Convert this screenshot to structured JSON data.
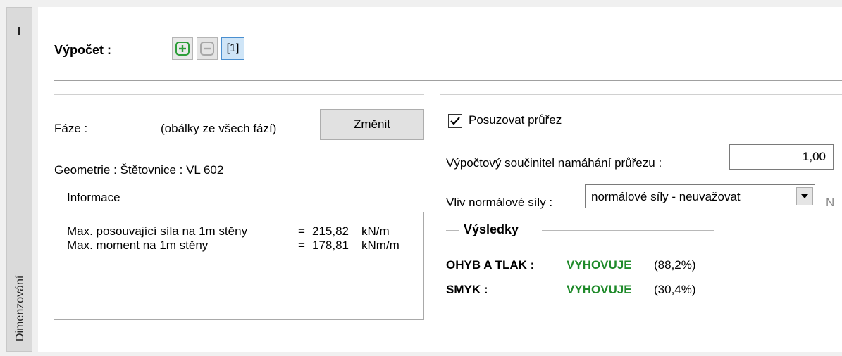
{
  "side_tab": {
    "label": "Dimenzování"
  },
  "toolbar": {
    "title": "Výpočet :",
    "add_label": "+",
    "remove_label": "−",
    "stage_label": "[1]"
  },
  "left": {
    "phase_label": "Fáze :",
    "phase_value": "(obálky ze všech fází)",
    "change_button": "Změnit",
    "geometry": "Geometrie : Štětovnice : VL 602",
    "info_group": "Informace",
    "info_rows": [
      {
        "name": "Max. posouvající síla na 1m stěny",
        "eq": "=",
        "value": "215,82",
        "unit": "kN/m"
      },
      {
        "name": "Max. moment na 1m stěny",
        "eq": "=",
        "value": "178,81",
        "unit": "kNm/m"
      }
    ]
  },
  "right": {
    "check_label": "Posuzovat průřez",
    "check_checked": true,
    "coef_label": "Výpočtový součinitel namáhání průřezu :",
    "coef_value": "1,00",
    "normal_label": "Vliv normálové síly :",
    "normal_value": "normálové síly - neuvažovat",
    "normal_suffix": "N",
    "results_group": "Výsledky",
    "results": [
      {
        "name": "OHYB A TLAK :",
        "status": "VYHOVUJE",
        "pct": "(88,2%)"
      },
      {
        "name": "SMYK :",
        "status": "VYHOVUJE",
        "pct": "(30,4%)"
      }
    ]
  },
  "colors": {
    "ok_green": "#1f8a2a",
    "add_green": "#2e9e3a"
  }
}
